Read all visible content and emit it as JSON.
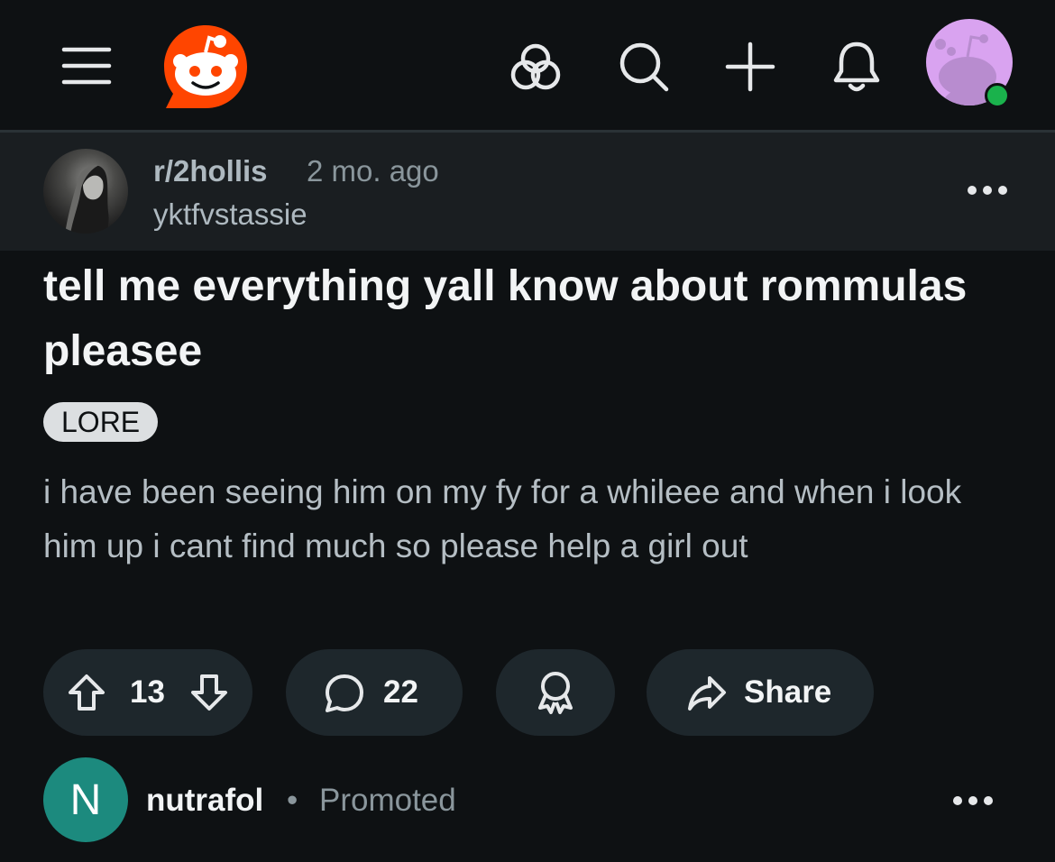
{
  "header": {
    "icons": [
      "menu-icon",
      "reddit-logo",
      "explore-icon",
      "search-icon",
      "plus-icon",
      "bell-icon",
      "user-avatar"
    ]
  },
  "post": {
    "subreddit": "r/2hollis",
    "age": "2 mo. ago",
    "author": "yktfvstassie",
    "title": "tell me everything yall know about rommulas pleasee",
    "flair": "LORE",
    "body": "i have been seeing him on my fy for a whileee and when i look him up i cant find much so please help a girl out",
    "votes": "13",
    "comments": "22",
    "share_label": "Share"
  },
  "promoted": {
    "avatar_letter": "N",
    "name": "nutrafol",
    "separator": "•",
    "label": "Promoted"
  },
  "colors": {
    "background": "#0e1113",
    "header_bg": "#1a1e21",
    "pill_bg": "#1e272c",
    "reddit_orange": "#ff4500",
    "online_green": "#1ab24c",
    "promo_teal": "#1c8a7e"
  }
}
